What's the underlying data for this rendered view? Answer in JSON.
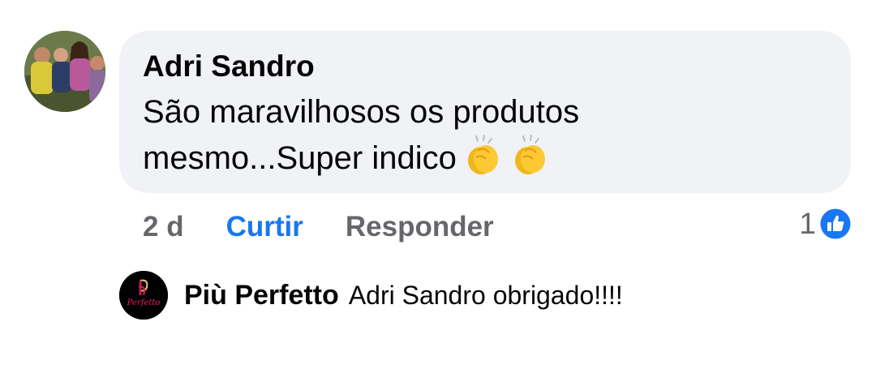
{
  "comment": {
    "author": "Adri Sandro",
    "text": "São maravilhosos os produtos mesmo...Super indico",
    "emoji": [
      "clapping-hands",
      "clapping-hands"
    ],
    "time": "2 d",
    "like_label": "Curtir",
    "reply_label": "Responder",
    "reaction_count": "1",
    "reaction_icon": "like-thumbs-up"
  },
  "reply": {
    "author": "Più Perfetto",
    "text": "Adri Sandro obrigado!!!!",
    "avatar_logo_text": "Perfetto"
  },
  "colors": {
    "bubble_bg": "#f0f2f5",
    "link_blue": "#1877f2",
    "secondary_text": "#65676b",
    "primary_text": "#050505"
  }
}
